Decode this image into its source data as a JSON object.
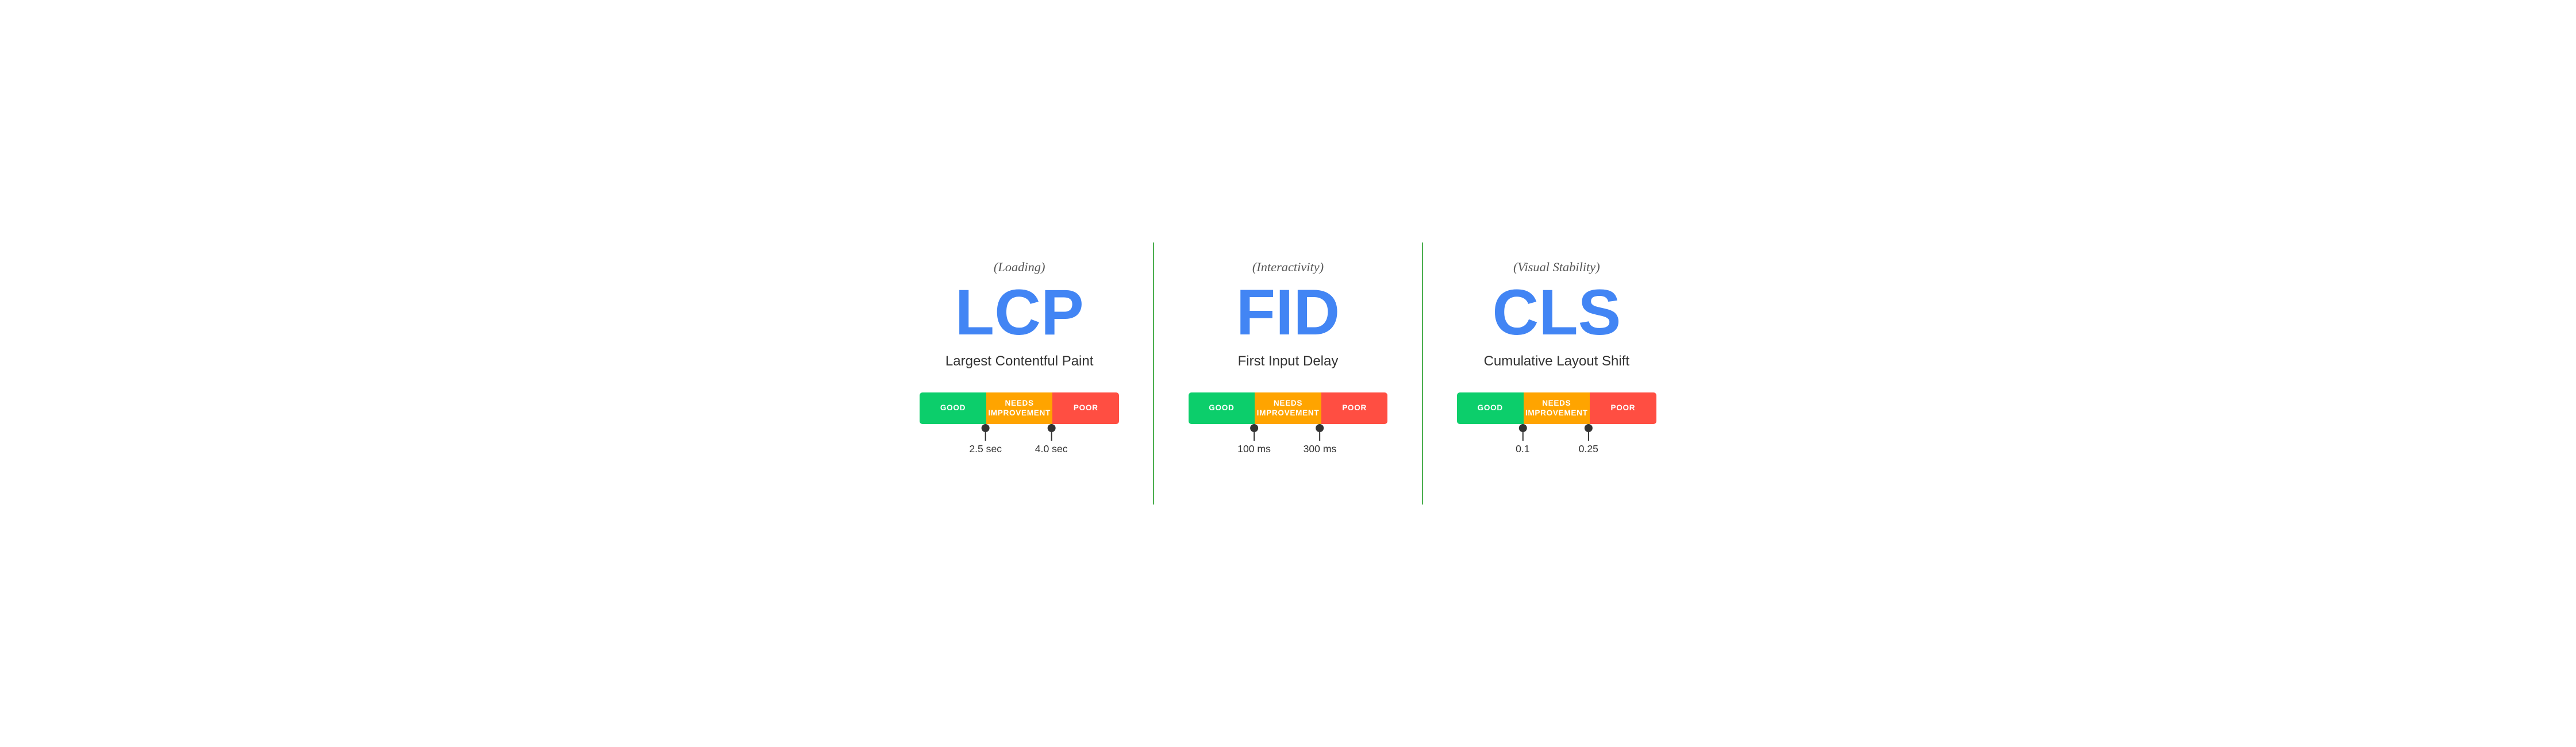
{
  "panels": [
    {
      "id": "lcp",
      "subtitle": "(Loading)",
      "acronym": "LCP",
      "fullname": "Largest Contentful Paint",
      "bar": {
        "good_flex": 3,
        "needs_flex": 3,
        "poor_flex": 3,
        "good_label": "GOOD",
        "needs_label": "NEEDS\nIMPROVEMENT",
        "poor_label": "POOR"
      },
      "markers": [
        {
          "label": "2.5 sec",
          "position_pct": 33
        },
        {
          "label": "4.0 sec",
          "position_pct": 66
        }
      ]
    },
    {
      "id": "fid",
      "subtitle": "(Interactivity)",
      "acronym": "FID",
      "fullname": "First Input Delay",
      "bar": {
        "good_flex": 3,
        "needs_flex": 3,
        "poor_flex": 3,
        "good_label": "GOOD",
        "needs_label": "NEEDS\nIMPROVEMENT",
        "poor_label": "POOR"
      },
      "markers": [
        {
          "label": "100 ms",
          "position_pct": 33
        },
        {
          "label": "300 ms",
          "position_pct": 66
        }
      ]
    },
    {
      "id": "cls",
      "subtitle": "(Visual Stability)",
      "acronym": "CLS",
      "fullname": "Cumulative Layout Shift",
      "bar": {
        "good_flex": 3,
        "needs_flex": 3,
        "poor_flex": 3,
        "good_label": "GOOD",
        "needs_label": "NEEDS\nIMPROVEMENT",
        "poor_label": "POOR"
      },
      "markers": [
        {
          "label": "0.1",
          "position_pct": 33
        },
        {
          "label": "0.25",
          "position_pct": 66
        }
      ]
    }
  ]
}
